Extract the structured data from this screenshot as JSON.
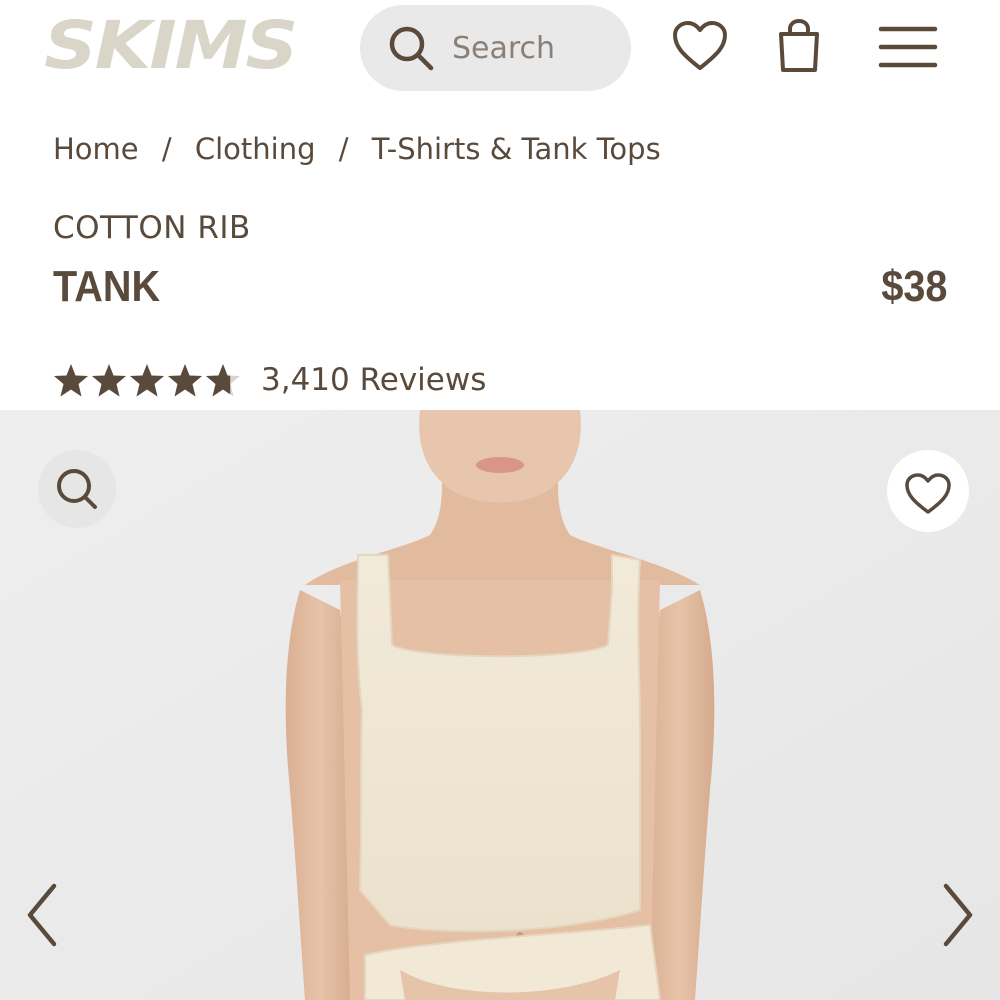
{
  "header": {
    "logo_text": "SKIMS",
    "search_placeholder": "Search",
    "icons": [
      "search-icon",
      "heart-icon",
      "shopping-bag-icon",
      "hamburger-menu-icon"
    ]
  },
  "breadcrumb": {
    "items": [
      "Home",
      "Clothing",
      "T-Shirts & Tank Tops"
    ],
    "separator": "/"
  },
  "product": {
    "eyebrow": "COTTON RIB",
    "name": "TANK",
    "price": "$38",
    "rating": 4.7,
    "reviews_label": "3,410 Reviews"
  },
  "gallery": {
    "icons": [
      "zoom-icon",
      "heart-icon",
      "chevron-left-icon",
      "chevron-right-icon"
    ]
  },
  "colors": {
    "text": "#5a4a3c",
    "logo": "#d9d6c9",
    "search_bg": "#e9e9e9",
    "gallery_bg": "#ececec",
    "tank": "#f1e8d6"
  }
}
